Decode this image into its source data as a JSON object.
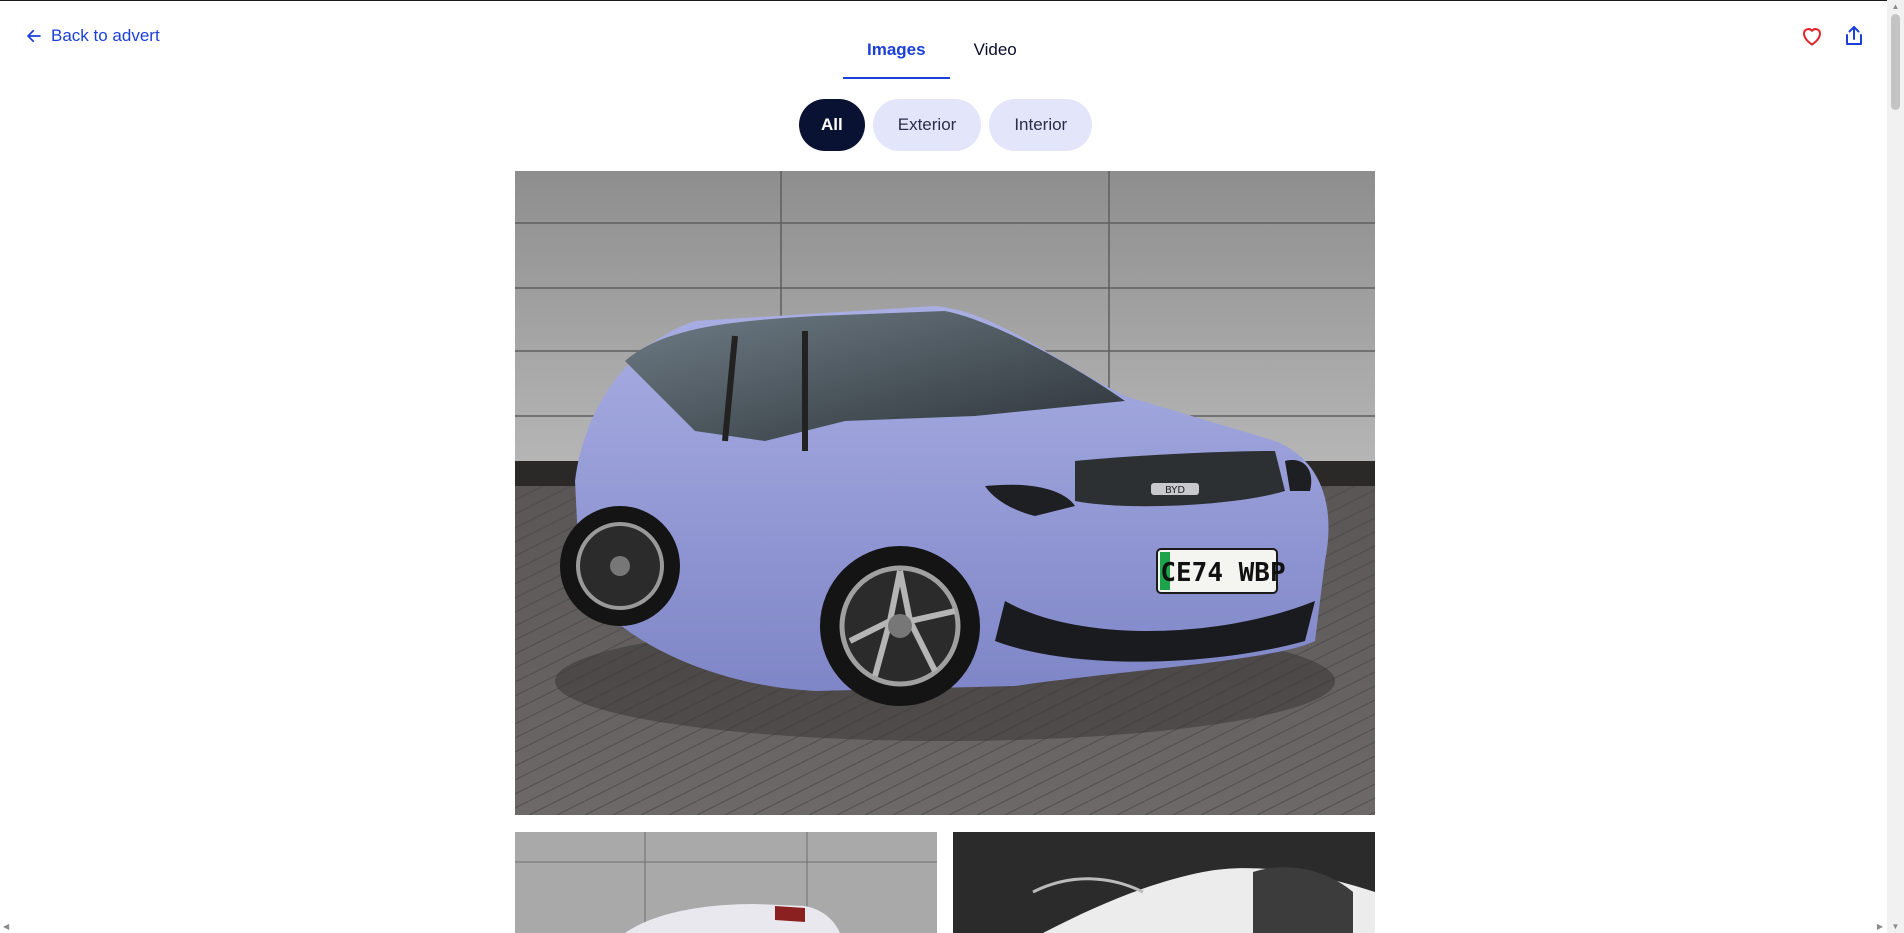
{
  "header": {
    "back_label": "Back to advert",
    "tabs": [
      {
        "label": "Images",
        "active": true
      },
      {
        "label": "Video",
        "active": false
      }
    ],
    "icons": [
      "heart-icon",
      "share-icon"
    ]
  },
  "filters": [
    {
      "label": "All",
      "active": true
    },
    {
      "label": "Exterior",
      "active": false
    },
    {
      "label": "Interior",
      "active": false
    }
  ],
  "photo": {
    "plate": "CE74 WBP",
    "badge": "BYD"
  },
  "colors": {
    "accent": "#1b3fd9",
    "pill_active": "#0a1233",
    "pill_inactive": "#e3e6fa",
    "favorite": "#e0242b"
  }
}
